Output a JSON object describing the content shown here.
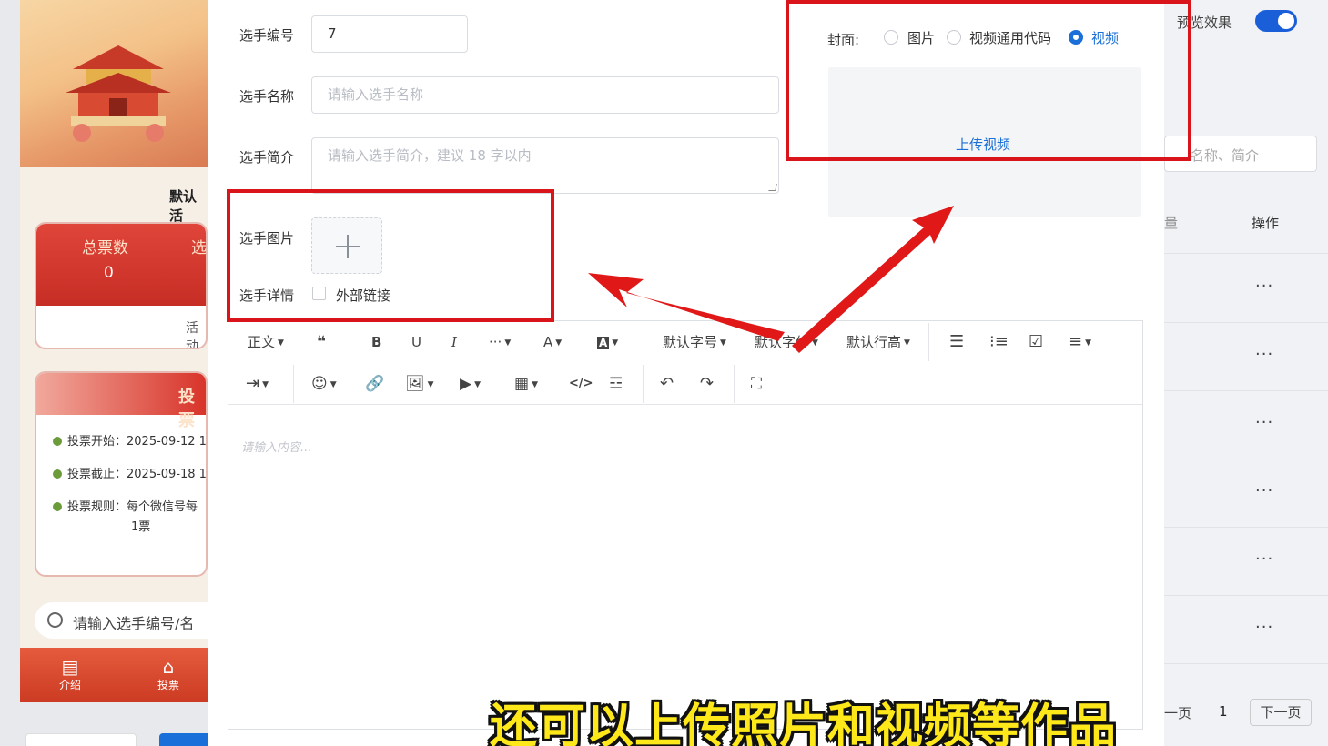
{
  "background": {
    "phone": {
      "default_label": "默认活",
      "stats": {
        "total_votes_label": "总票数",
        "players_label": "选",
        "total_votes_value": "0",
        "footer": "活动"
      },
      "vote_card": {
        "title": "投票",
        "start": "投票开始：2025-09-12 1",
        "end": "投票截止：2025-09-18 1",
        "rule": "投票规则：每个微信号每",
        "rule_cont": "1票"
      },
      "search_placeholder": "请输入选手编号/名",
      "tabs": [
        {
          "label": "介绍",
          "icon": "doc-icon"
        },
        {
          "label": "投票",
          "icon": "home-icon"
        }
      ]
    },
    "right": {
      "preview_label": "预览效果",
      "search_placeholder": "名称、简介",
      "col_pre": "量",
      "col_ops": "操作",
      "row_action": "···",
      "pager_prev": "一页",
      "pager_current": "1",
      "pager_next": "下一页"
    }
  },
  "form": {
    "number_label": "选手编号",
    "number_value": "7",
    "name_label": "选手名称",
    "name_placeholder": "请输入选手名称",
    "intro_label": "选手简介",
    "intro_placeholder": "请输入选手简介，建议 18 字以内",
    "image_label": "选手图片",
    "detail_label": "选手详情",
    "external_link_label": "外部链接",
    "cover_label": "封面:",
    "cover_options": [
      {
        "label": "图片",
        "selected": false
      },
      {
        "label": "视频通用代码",
        "selected": false
      },
      {
        "label": "视频",
        "selected": true
      }
    ],
    "upload_video": "上传视频"
  },
  "editor": {
    "toolbar": {
      "paragraph": "正文",
      "font_size": "默认字号",
      "font_family": "默认字体",
      "line_height": "默认行高"
    },
    "placeholder": "请输入内容..."
  },
  "caption": "还可以上传照片和视频等作品",
  "colors": {
    "accent": "#1a6fd8",
    "annotation": "#d9141b",
    "caption": "#ffe81a"
  }
}
